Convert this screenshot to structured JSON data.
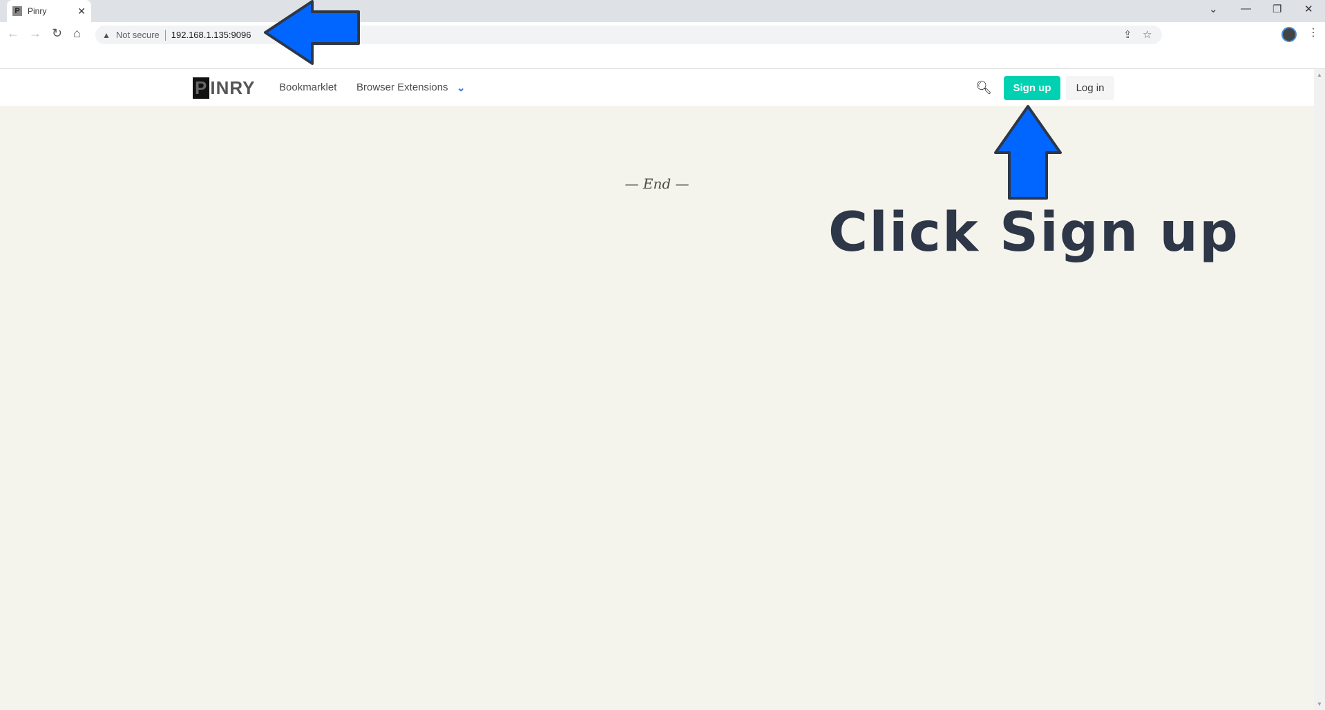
{
  "browser": {
    "tab_title": "Pinry",
    "tab_favicon": "P",
    "security_label": "Not secure",
    "url": "192.168.1.135:9096"
  },
  "nav": {
    "logo": "PINRY",
    "links": [
      "Bookmarklet",
      "Browser Extensions"
    ],
    "signup": "Sign up",
    "login": "Log in"
  },
  "main": {
    "end_text": "— End —"
  },
  "annotation": {
    "text": "Click Sign up",
    "arrow_color": "#0066ff",
    "outline_color": "#2d3748"
  },
  "colors": {
    "primary": "#00d1b2",
    "background": "#f4f4ec"
  }
}
